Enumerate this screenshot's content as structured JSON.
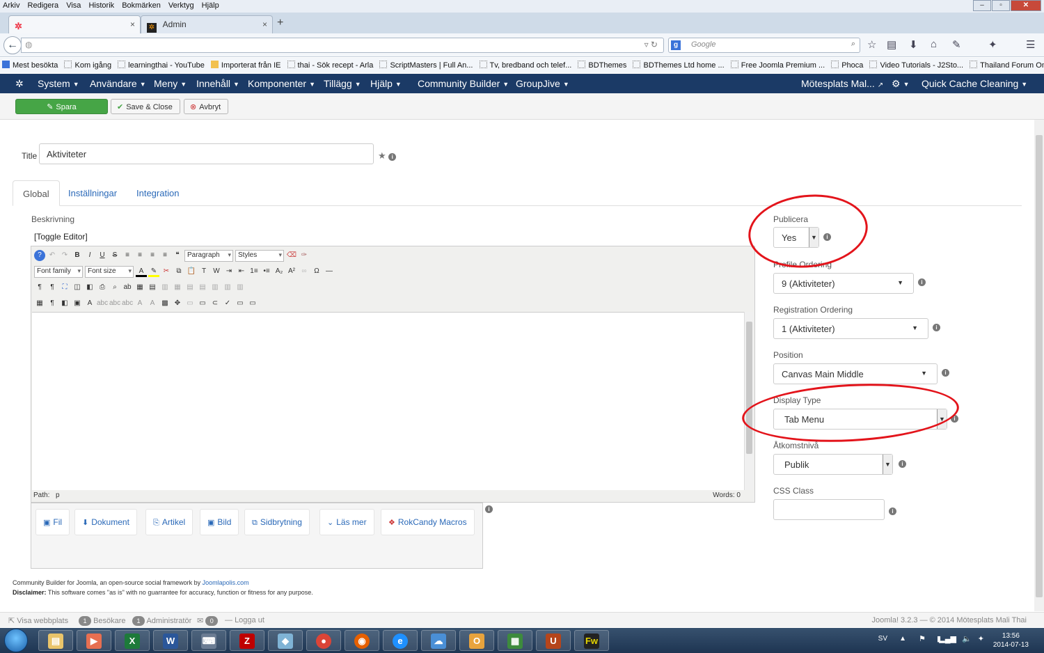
{
  "browser": {
    "menu": [
      "Arkiv",
      "Redigera",
      "Visa",
      "Historik",
      "Bokmärken",
      "Verktyg",
      "Hjälp"
    ],
    "tabs": [
      {
        "label": ""
      },
      {
        "label": "Admin"
      }
    ],
    "search_placeholder": "Google",
    "bookmarks": [
      "Mest besökta",
      "Kom igång",
      "learningthai - YouTube",
      "Importerat från IE",
      "thai - Sök recept - Arla",
      "ScriptMasters | Full An...",
      "Tv, bredband och telef...",
      "BDThemes",
      "BDThemes Ltd home ...",
      "Free Joomla Premium ...",
      "Phoca",
      "Video Tutorials - J2Sto...",
      "Thailand Forum Om R..."
    ]
  },
  "joomla_nav": {
    "left": [
      "System",
      "Användare",
      "Meny",
      "Innehåll",
      "Komponenter",
      "Tillägg",
      "Hjälp",
      "Community Builder",
      "GroupJive"
    ],
    "site": "Mötesplats Mal...",
    "quick_cache": "Quick Cache Cleaning"
  },
  "toolbar": {
    "save": "Spara",
    "save_close": "Save & Close",
    "cancel": "Avbryt"
  },
  "form": {
    "title_label": "Title",
    "title_value": "Aktiviteter",
    "tabs": [
      "Global",
      "Inställningar",
      "Integration"
    ],
    "beskrivning_label": "Beskrivning",
    "toggle_editor": "[Toggle Editor]",
    "editor": {
      "paragraph": "Paragraph",
      "styles": "Styles",
      "font_family": "Font family",
      "font_size": "Font size",
      "path_label": "Path:",
      "path_value": "p",
      "words": "Words: 0"
    },
    "editor_buttons": [
      "Fil",
      "Dokument",
      "Artikel",
      "Bild",
      "Sidbrytning",
      "Läs mer",
      "RokCandy Macros"
    ]
  },
  "right": {
    "publicera_label": "Publicera",
    "publicera_value": "Yes",
    "profile_ordering_label": "Profile Ordering",
    "profile_ordering_value": "9 (Aktiviteter)",
    "registration_ordering_label": "Registration Ordering",
    "registration_ordering_value": "1 (Aktiviteter)",
    "position_label": "Position",
    "position_value": "Canvas Main Middle",
    "display_type_label": "Display Type",
    "display_type_value": "Tab Menu",
    "access_label": "Åtkomstnivå",
    "access_value": "Publik",
    "css_class_label": "CSS Class",
    "css_class_value": ""
  },
  "footer": {
    "cb_line_prefix": "Community Builder for Joomla, an open-source social framework by",
    "cb_link": "Joomlapolis.com",
    "disclaimer_label": "Disclaimer:",
    "disclaimer_text": "This software comes \"as is\" with no guarrantee for accuracy, function or fitness for any purpose."
  },
  "status": {
    "view_site": "Visa webbplats",
    "visitors_count": "1",
    "visitors": "Besökare",
    "admins_count": "1",
    "admins": "Administratör",
    "messages_count": "0",
    "logout": "Logga ut",
    "version": "Joomla! 3.2.3 — © 2014 Mötesplats Mali Thai"
  },
  "taskbar": {
    "lang": "SV",
    "time": "13:56",
    "date": "2014-07-13"
  },
  "colors": {
    "joomla_nav": "#1b3a66",
    "save_green": "#46a546",
    "annotation_red": "#e3141b",
    "link_blue": "#2a69b8"
  }
}
